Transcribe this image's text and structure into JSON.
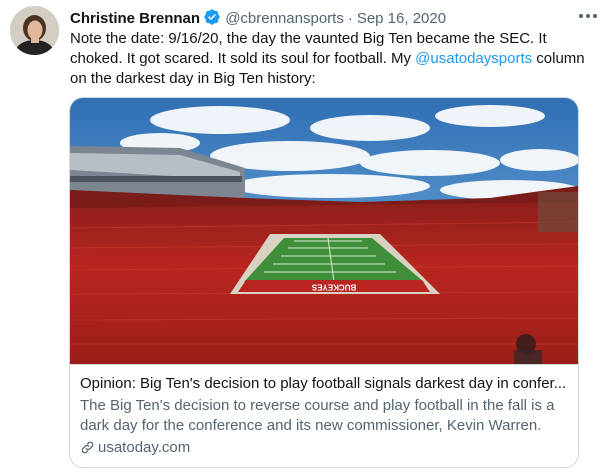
{
  "tweet": {
    "author_name": "Christine Brennan",
    "handle": "@cbrennansports",
    "separator": "·",
    "date": "Sep 16, 2020",
    "text_before_mention": "Note the date: 9/16/20, the day the vaunted Big Ten became the SEC. It choked. It got scared. It sold its soul for football. My ",
    "mention": "@usatodaysports",
    "text_after_mention": " column on the darkest day in Big Ten history:"
  },
  "card": {
    "title": "Opinion: Big Ten's decision to play football signals darkest day in confer...",
    "description": "The Big Ten's decision to reverse course and play football in the fall is a dark day for the conference and its new commissioner, Kevin Warren.",
    "domain": "usatoday.com",
    "image_endzone_text": "BUCKEYES"
  },
  "icons": {
    "verified": "verified-badge-icon",
    "more": "more-options-icon",
    "link": "link-icon"
  },
  "colors": {
    "link_blue": "#1d9bf0",
    "secondary_text": "#536471",
    "border": "#cfd9de",
    "stadium_red": "#b8261f",
    "field_green": "#3f8f3a"
  }
}
